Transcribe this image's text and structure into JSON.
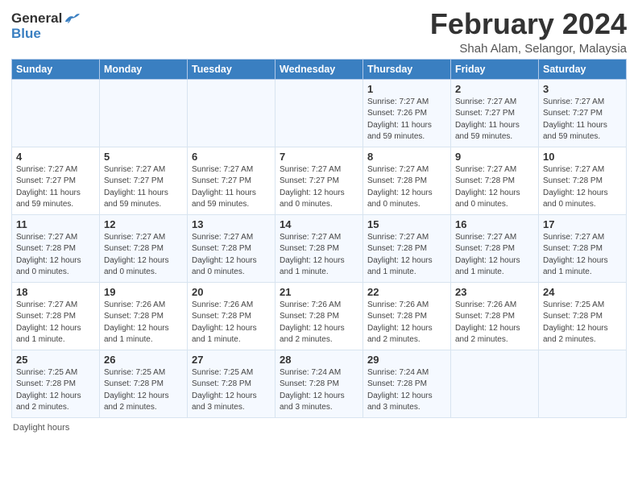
{
  "logo": {
    "general": "General",
    "blue": "Blue"
  },
  "title": {
    "month_year": "February 2024",
    "location": "Shah Alam, Selangor, Malaysia"
  },
  "days_of_week": [
    "Sunday",
    "Monday",
    "Tuesday",
    "Wednesday",
    "Thursday",
    "Friday",
    "Saturday"
  ],
  "weeks": [
    [
      {
        "day": "",
        "info": ""
      },
      {
        "day": "",
        "info": ""
      },
      {
        "day": "",
        "info": ""
      },
      {
        "day": "",
        "info": ""
      },
      {
        "day": "1",
        "info": "Sunrise: 7:27 AM\nSunset: 7:26 PM\nDaylight: 11 hours\nand 59 minutes."
      },
      {
        "day": "2",
        "info": "Sunrise: 7:27 AM\nSunset: 7:27 PM\nDaylight: 11 hours\nand 59 minutes."
      },
      {
        "day": "3",
        "info": "Sunrise: 7:27 AM\nSunset: 7:27 PM\nDaylight: 11 hours\nand 59 minutes."
      }
    ],
    [
      {
        "day": "4",
        "info": "Sunrise: 7:27 AM\nSunset: 7:27 PM\nDaylight: 11 hours\nand 59 minutes."
      },
      {
        "day": "5",
        "info": "Sunrise: 7:27 AM\nSunset: 7:27 PM\nDaylight: 11 hours\nand 59 minutes."
      },
      {
        "day": "6",
        "info": "Sunrise: 7:27 AM\nSunset: 7:27 PM\nDaylight: 11 hours\nand 59 minutes."
      },
      {
        "day": "7",
        "info": "Sunrise: 7:27 AM\nSunset: 7:27 PM\nDaylight: 12 hours\nand 0 minutes."
      },
      {
        "day": "8",
        "info": "Sunrise: 7:27 AM\nSunset: 7:28 PM\nDaylight: 12 hours\nand 0 minutes."
      },
      {
        "day": "9",
        "info": "Sunrise: 7:27 AM\nSunset: 7:28 PM\nDaylight: 12 hours\nand 0 minutes."
      },
      {
        "day": "10",
        "info": "Sunrise: 7:27 AM\nSunset: 7:28 PM\nDaylight: 12 hours\nand 0 minutes."
      }
    ],
    [
      {
        "day": "11",
        "info": "Sunrise: 7:27 AM\nSunset: 7:28 PM\nDaylight: 12 hours\nand 0 minutes."
      },
      {
        "day": "12",
        "info": "Sunrise: 7:27 AM\nSunset: 7:28 PM\nDaylight: 12 hours\nand 0 minutes."
      },
      {
        "day": "13",
        "info": "Sunrise: 7:27 AM\nSunset: 7:28 PM\nDaylight: 12 hours\nand 0 minutes."
      },
      {
        "day": "14",
        "info": "Sunrise: 7:27 AM\nSunset: 7:28 PM\nDaylight: 12 hours\nand 1 minute."
      },
      {
        "day": "15",
        "info": "Sunrise: 7:27 AM\nSunset: 7:28 PM\nDaylight: 12 hours\nand 1 minute."
      },
      {
        "day": "16",
        "info": "Sunrise: 7:27 AM\nSunset: 7:28 PM\nDaylight: 12 hours\nand 1 minute."
      },
      {
        "day": "17",
        "info": "Sunrise: 7:27 AM\nSunset: 7:28 PM\nDaylight: 12 hours\nand 1 minute."
      }
    ],
    [
      {
        "day": "18",
        "info": "Sunrise: 7:27 AM\nSunset: 7:28 PM\nDaylight: 12 hours\nand 1 minute."
      },
      {
        "day": "19",
        "info": "Sunrise: 7:26 AM\nSunset: 7:28 PM\nDaylight: 12 hours\nand 1 minute."
      },
      {
        "day": "20",
        "info": "Sunrise: 7:26 AM\nSunset: 7:28 PM\nDaylight: 12 hours\nand 1 minute."
      },
      {
        "day": "21",
        "info": "Sunrise: 7:26 AM\nSunset: 7:28 PM\nDaylight: 12 hours\nand 2 minutes."
      },
      {
        "day": "22",
        "info": "Sunrise: 7:26 AM\nSunset: 7:28 PM\nDaylight: 12 hours\nand 2 minutes."
      },
      {
        "day": "23",
        "info": "Sunrise: 7:26 AM\nSunset: 7:28 PM\nDaylight: 12 hours\nand 2 minutes."
      },
      {
        "day": "24",
        "info": "Sunrise: 7:25 AM\nSunset: 7:28 PM\nDaylight: 12 hours\nand 2 minutes."
      }
    ],
    [
      {
        "day": "25",
        "info": "Sunrise: 7:25 AM\nSunset: 7:28 PM\nDaylight: 12 hours\nand 2 minutes."
      },
      {
        "day": "26",
        "info": "Sunrise: 7:25 AM\nSunset: 7:28 PM\nDaylight: 12 hours\nand 2 minutes."
      },
      {
        "day": "27",
        "info": "Sunrise: 7:25 AM\nSunset: 7:28 PM\nDaylight: 12 hours\nand 3 minutes."
      },
      {
        "day": "28",
        "info": "Sunrise: 7:24 AM\nSunset: 7:28 PM\nDaylight: 12 hours\nand 3 minutes."
      },
      {
        "day": "29",
        "info": "Sunrise: 7:24 AM\nSunset: 7:28 PM\nDaylight: 12 hours\nand 3 minutes."
      },
      {
        "day": "",
        "info": ""
      },
      {
        "day": "",
        "info": ""
      }
    ]
  ],
  "footer": {
    "daylight_hours": "Daylight hours"
  }
}
